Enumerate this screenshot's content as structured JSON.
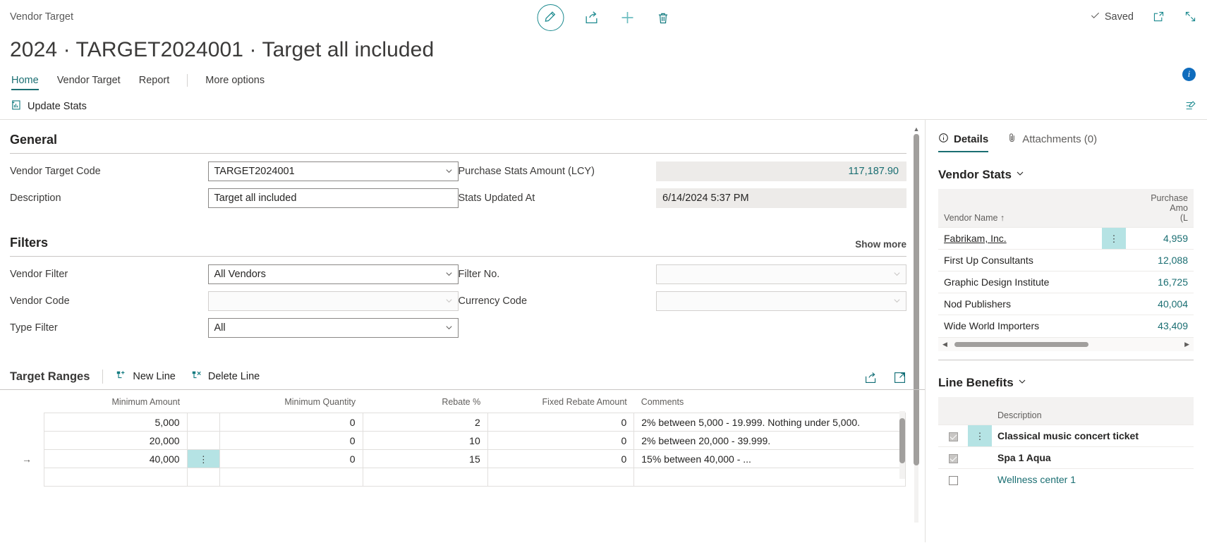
{
  "header": {
    "breadcrumb": "Vendor Target",
    "page_title": "2024 · TARGET2024001 · Target all included",
    "saved_label": "Saved",
    "icons": {
      "edit": "pencil-icon",
      "share": "share-icon",
      "new": "plus-icon",
      "delete": "trash-icon",
      "open_new_window": "open-in-new-window-icon",
      "collapse": "collapse-icon"
    }
  },
  "tabs": [
    {
      "label": "Home",
      "active": true
    },
    {
      "label": "Vendor Target",
      "active": false
    },
    {
      "label": "Report",
      "active": false
    },
    {
      "label": "More options",
      "active": false
    }
  ],
  "info_badge": "i",
  "action_bar": {
    "update_stats_label": "Update Stats",
    "personalize_icon": "personalize-icon"
  },
  "general": {
    "title": "General",
    "fields": [
      {
        "label": "Vendor Target Code",
        "value": "TARGET2024001",
        "type": "dropdown",
        "state": "editable"
      },
      {
        "label": "Description",
        "value": "Target all included",
        "type": "text",
        "state": "editable"
      },
      {
        "label": "Purchase Stats Amount (LCY)",
        "value": "117,187.90",
        "type": "readonly-number",
        "state": "readonly"
      },
      {
        "label": "Stats Updated At",
        "value": "6/14/2024 5:37 PM",
        "type": "readonly-text",
        "state": "readonly"
      }
    ]
  },
  "filters": {
    "title": "Filters",
    "show_more": "Show more",
    "fields": [
      {
        "label": "Vendor Filter",
        "value": "All Vendors",
        "type": "dropdown",
        "state": "editable"
      },
      {
        "label": "Vendor Code",
        "value": "",
        "type": "dropdown",
        "state": "disabled"
      },
      {
        "label": "Type Filter",
        "value": "All",
        "type": "dropdown",
        "state": "editable"
      },
      {
        "label": "Filter No.",
        "value": "",
        "type": "dropdown",
        "state": "disabled"
      },
      {
        "label": "Currency Code",
        "value": "",
        "type": "dropdown",
        "state": "disabled"
      }
    ]
  },
  "target_ranges": {
    "title": "Target Ranges",
    "new_line_label": "New Line",
    "delete_line_label": "Delete Line",
    "share_icon": "share-icon",
    "expand_icon": "open-full-page-icon",
    "columns": [
      "Minimum Amount",
      "Minimum Quantity",
      "Rebate %",
      "Fixed Rebate Amount",
      "Comments"
    ],
    "rows": [
      {
        "selected": false,
        "minimum_amount": "5,000",
        "minimum_quantity": "0",
        "rebate_pct": "2",
        "fixed_rebate_amount": "0",
        "comments": "2% between 5,000 - 19.999. Nothing under 5,000."
      },
      {
        "selected": false,
        "minimum_amount": "20,000",
        "minimum_quantity": "0",
        "rebate_pct": "10",
        "fixed_rebate_amount": "0",
        "comments": "2% between 20,000 - 39.999."
      },
      {
        "selected": true,
        "minimum_amount": "40,000",
        "minimum_quantity": "0",
        "rebate_pct": "15",
        "fixed_rebate_amount": "0",
        "comments": "15% between 40,000 - ..."
      }
    ]
  },
  "factbox": {
    "tabs": [
      {
        "label": "Details",
        "icon": "info-icon",
        "active": true
      },
      {
        "label": "Attachments (0)",
        "icon": "paperclip-icon",
        "active": false
      }
    ],
    "vendor_stats": {
      "title": "Vendor Stats",
      "columns": [
        "Vendor Name ↑",
        "Purchase Amo… (L…"
      ],
      "col_name": "Vendor Name ↑",
      "col_amount_line1": "Purchase Amo",
      "col_amount_line2": "(L",
      "rows": [
        {
          "name": "Fabrikam, Inc.",
          "amount": "4,959",
          "selected": true,
          "link": true
        },
        {
          "name": "First Up Consultants",
          "amount": "12,088",
          "selected": false,
          "link": false
        },
        {
          "name": "Graphic Design Institute",
          "amount": "16,725",
          "selected": false,
          "link": false
        },
        {
          "name": "Nod Publishers",
          "amount": "40,004",
          "selected": false,
          "link": false
        },
        {
          "name": "Wide World Importers",
          "amount": "43,409",
          "selected": false,
          "link": false
        }
      ]
    },
    "line_benefits": {
      "title": "Line Benefits",
      "col_description": "Description",
      "rows": [
        {
          "checked": true,
          "description": "Classical music concert ticket",
          "selected": true,
          "bold": true,
          "link": false
        },
        {
          "checked": true,
          "description": "Spa 1 Aqua",
          "selected": false,
          "bold": true,
          "link": false
        },
        {
          "checked": false,
          "description": "Wellness center 1",
          "selected": false,
          "bold": false,
          "link": true
        }
      ]
    }
  },
  "colors": {
    "accent_teal": "#1a6e72",
    "selection_teal": "#b5e3e4",
    "info_blue": "#0f6cbd",
    "border_grey": "#c8c6c4"
  }
}
